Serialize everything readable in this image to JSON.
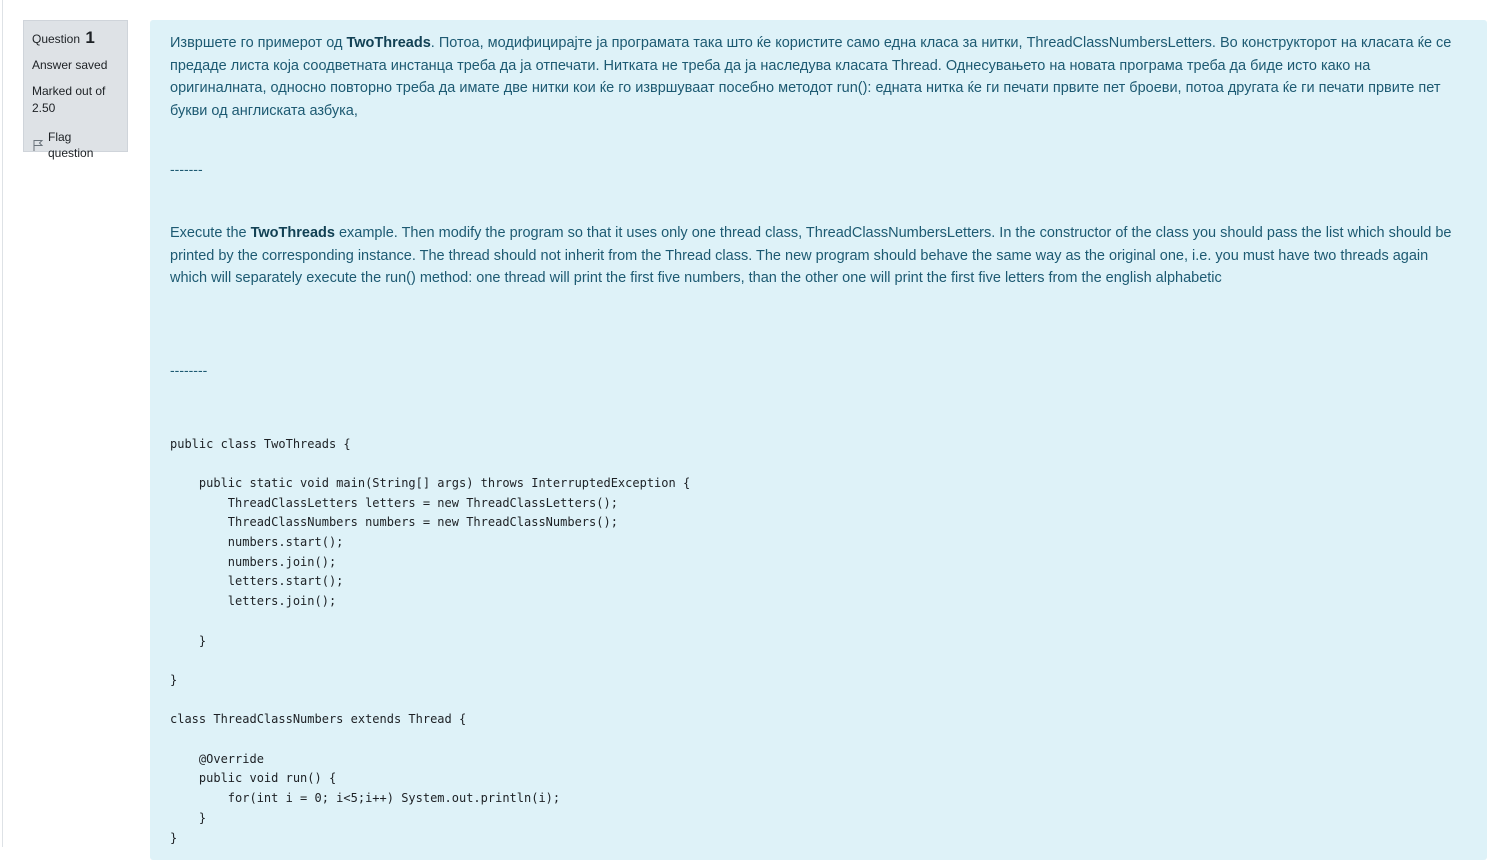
{
  "info": {
    "question_label": "Question",
    "question_number": "1",
    "state": "Answer saved",
    "grade_line1": "Marked out of",
    "grade_line2": "2.50",
    "flag_label": "Flag question"
  },
  "question": {
    "mk_text_1": "Извршете го примерот од ",
    "mk_bold": "TwoThreads",
    "mk_text_2": ". Потоа, модифицирајте ја програмата така што ќе користите само една класа за нитки, ThreadClassNumbersLetters. Во конструкторот на класата ќе се предаде листа која соодветната инстанца треба да ја отпечати. Нитката не треба да ја наследува класата Thread. Однесувањето на новата програма треба да биде исто како на оригиналната, односно повторно треба да имате две нитки кои ќе го извршуваат посебно методот run(): едната нитка ќе ги печати првите пет броеви, потоа другата ќе ги печати првите пет букви од англиската азбука,",
    "separator_1": "-------",
    "en_text_1": "Execute the ",
    "en_bold": "TwoThreads",
    "en_text_2": " example. Then modify the program so that it uses only one thread class, ThreadClassNumbersLetters. In the constructor of the class you should pass the list which should be printed by the corresponding instance. The thread should not inherit from the Thread class. The new program should behave the same way as the original one, i.e. you must have two threads again which will separately execute the run() method: one thread will print the first five numbers, than the other one will print the first five letters from the english alphabetic",
    "separator_2": "--------",
    "code": "public class TwoThreads {\n\n    public static void main(String[] args) throws InterruptedException {\n        ThreadClassLetters letters = new ThreadClassLetters();\n        ThreadClassNumbers numbers = new ThreadClassNumbers();\n        numbers.start();\n        numbers.join();\n        letters.start();\n        letters.join();\n\n    }\n\n}\n\nclass ThreadClassNumbers extends Thread {\n\n    @Override\n    public void run() {\n        for(int i = 0; i<5;i++) System.out.println(i);\n    }\n}"
  }
}
